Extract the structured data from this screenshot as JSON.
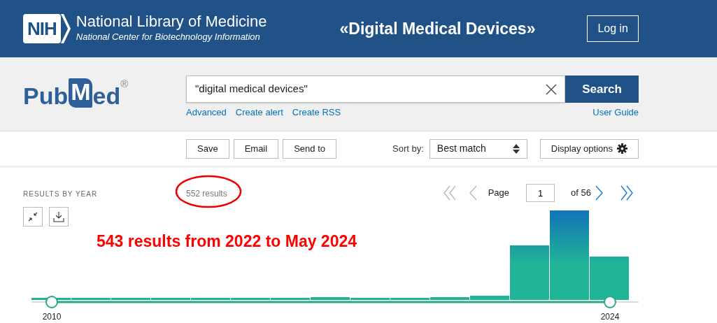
{
  "header": {
    "logo_text": "NIH",
    "title": "National Library of Medicine",
    "subtitle": "National Center for Biotechnology Information",
    "banner_title": "«Digital Medical Devices»",
    "login": "Log in"
  },
  "pubmed_logo": {
    "parts": [
      "Pub",
      "M",
      "ed"
    ],
    "registered": "®"
  },
  "search": {
    "value": "\"digital medical devices\"",
    "button": "Search",
    "links": [
      "Advanced",
      "Create alert",
      "Create RSS"
    ],
    "user_guide": "User Guide"
  },
  "toolbar": {
    "buttons": [
      "Save",
      "Email",
      "Send to"
    ],
    "sort_label": "Sort by:",
    "sort_value": "Best match",
    "display_options": "Display options"
  },
  "results": {
    "heading": "RESULTS BY YEAR",
    "count": "552 results",
    "count_circled": true,
    "pagination": {
      "first_disabled": true,
      "prev_disabled": true,
      "page_label": "Page",
      "page_value": "1",
      "of_pages": "of 56",
      "next_disabled": false,
      "last_disabled": false
    },
    "annotation": "543 results from 2022 to May 2024",
    "year_labels": [
      "2010",
      "2024"
    ]
  }
}
